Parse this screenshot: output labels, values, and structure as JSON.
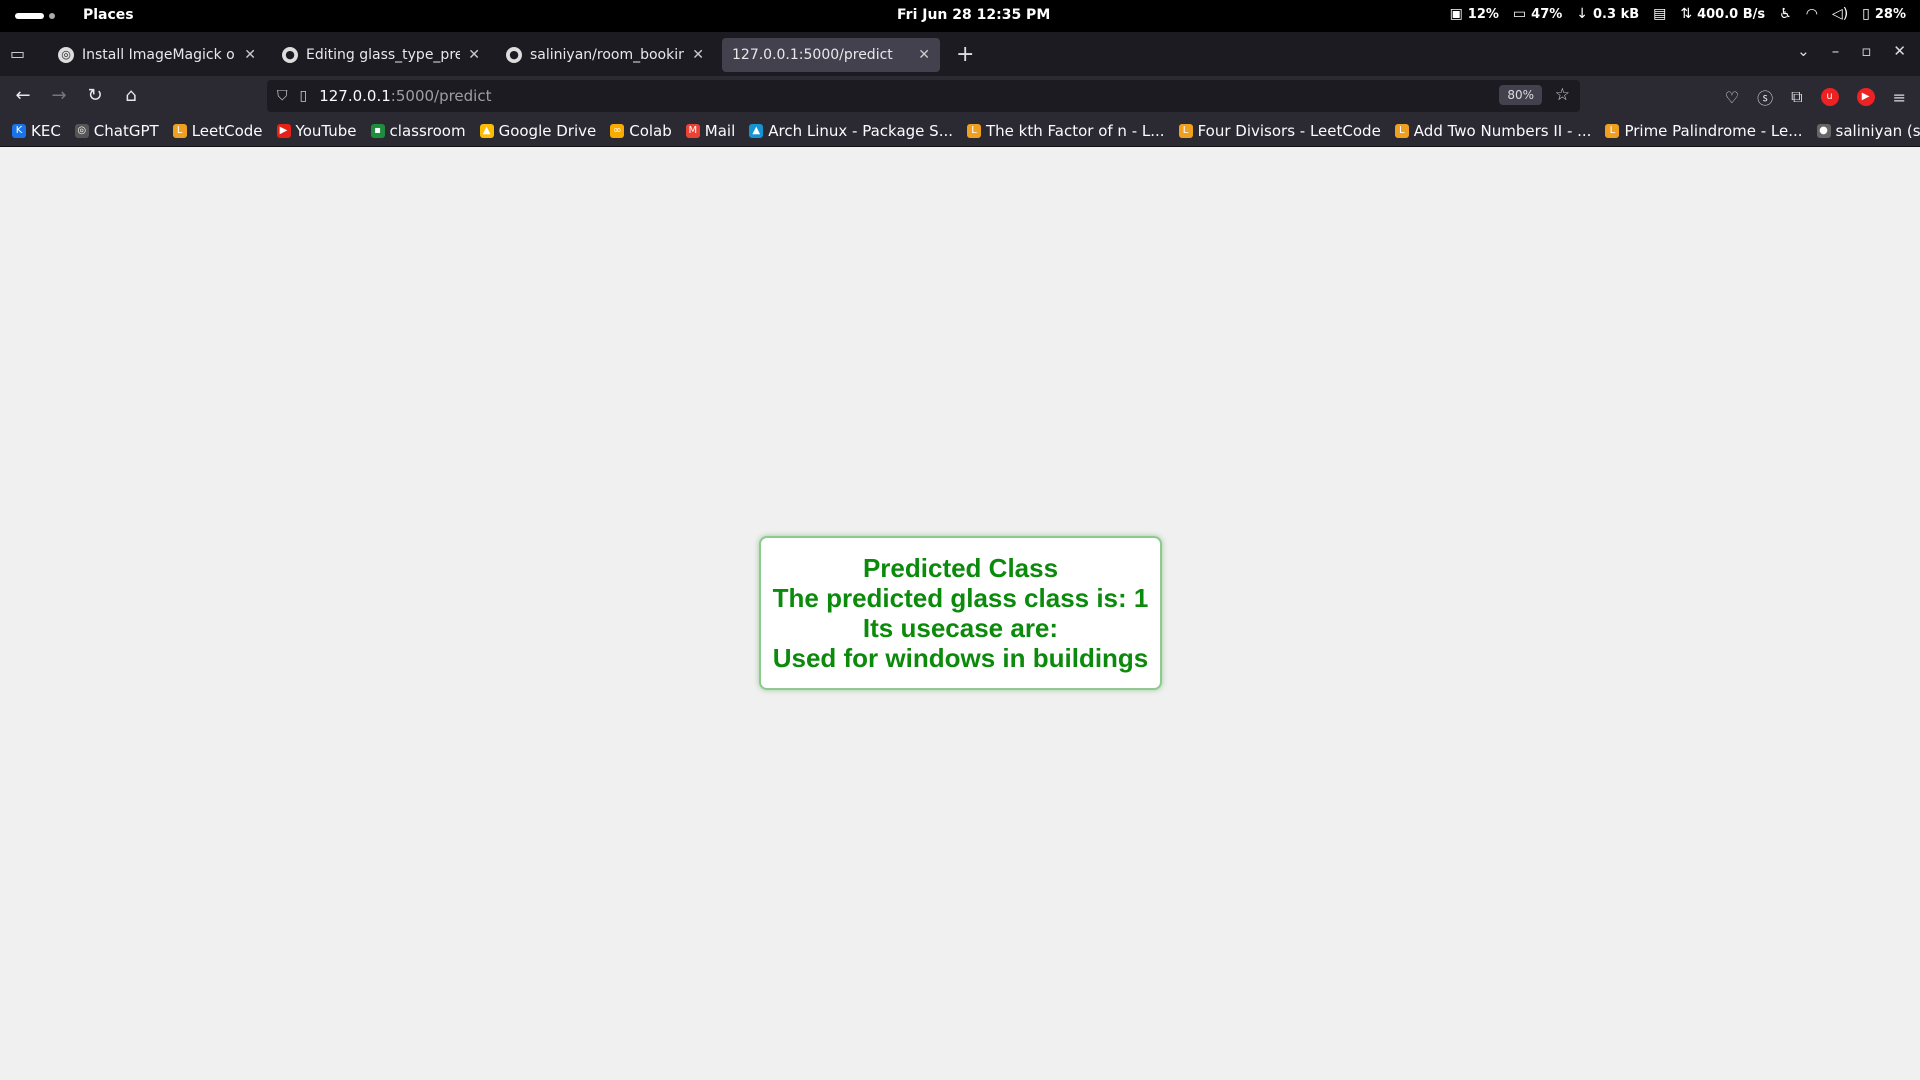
{
  "system_bar": {
    "places": "Places",
    "clock": "Fri Jun 28  12:35 PM",
    "cpu": "12%",
    "mem": "47%",
    "download": "0.3 kB",
    "network": "400.0 B/s",
    "battery": "28%"
  },
  "tabs": [
    {
      "title": "Install ImageMagick on A",
      "icon": "chatgpt-icon",
      "active": false
    },
    {
      "title": "Editing glass_type_predic",
      "icon": "github-icon",
      "active": false
    },
    {
      "title": "saliniyan/room_booking",
      "icon": "github-icon",
      "active": false
    },
    {
      "title": "127.0.0.1:5000/predict",
      "icon": "",
      "active": true
    }
  ],
  "address_bar": {
    "host": "127.0.0.1",
    "path": ":5000/predict",
    "zoom": "80%"
  },
  "bookmarks": [
    {
      "label": "KEC",
      "icon": "kec-icon",
      "color": "#1a73e8"
    },
    {
      "label": "ChatGPT",
      "icon": "chatgpt-icon",
      "color": "#555555"
    },
    {
      "label": "LeetCode",
      "icon": "leetcode-icon",
      "color": "#f0a020"
    },
    {
      "label": "YouTube",
      "icon": "youtube-icon",
      "color": "#e62117"
    },
    {
      "label": "classroom",
      "icon": "classroom-icon",
      "color": "#1e8e3e"
    },
    {
      "label": "Google Drive",
      "icon": "drive-icon",
      "color": "#fbbc04"
    },
    {
      "label": "Colab",
      "icon": "colab-icon",
      "color": "#f9ab00"
    },
    {
      "label": "Mail",
      "icon": "mail-icon",
      "color": "#ea4335"
    },
    {
      "label": "Arch Linux - Package S...",
      "icon": "arch-icon",
      "color": "#1793d1"
    },
    {
      "label": "The kth Factor of n - L...",
      "icon": "leetcode-icon",
      "color": "#f0a020"
    },
    {
      "label": "Four Divisors - LeetCode",
      "icon": "leetcode-icon",
      "color": "#f0a020"
    },
    {
      "label": "Add Two Numbers II - ...",
      "icon": "leetcode-icon",
      "color": "#f0a020"
    },
    {
      "label": "Prime Palindrome - Le...",
      "icon": "leetcode-icon",
      "color": "#f0a020"
    },
    {
      "label": "saliniyan (saliniyan)",
      "icon": "github-icon",
      "color": "#666666"
    }
  ],
  "result": {
    "heading": "Predicted Class",
    "prediction": "The predicted glass class is: 1",
    "usecase_heading": "Its usecase are:",
    "usecase": "Used for windows in buildings",
    "text_color": "#0b8a0b"
  }
}
